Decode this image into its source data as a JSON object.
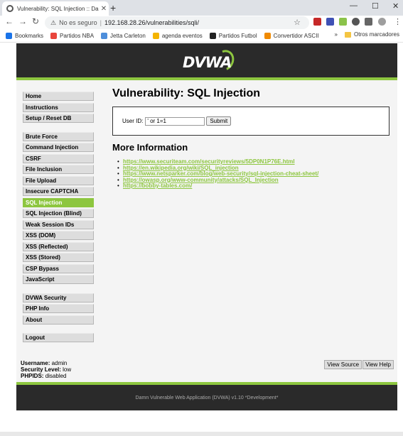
{
  "browser": {
    "tab_title": "Vulnerability: SQL Injection :: Damn",
    "tab_close": "✕",
    "new_tab": "+",
    "window_min": "—",
    "window_max": "☐",
    "window_close": "✕",
    "nav_back": "←",
    "nav_forward": "→",
    "nav_reload": "↻",
    "security_label": "No es seguro",
    "url": "192.168.28.26/vulnerabilities/sqli/",
    "bookmarks": [
      {
        "label": "Bookmarks",
        "icon": "star-icon",
        "color": "#1a73e8"
      },
      {
        "label": "Partidos NBA",
        "icon": "partidos-nba-icon",
        "color": "#e8453c"
      },
      {
        "label": "Jetta Carleton",
        "icon": "jetta-icon",
        "color": "#4d8edb"
      },
      {
        "label": "agenda eventos",
        "icon": "agenda-icon",
        "color": "#f4b400"
      },
      {
        "label": "Partidos Futbol",
        "icon": "futbol-icon",
        "color": "#222222"
      },
      {
        "label": "Convertidor ASCII",
        "icon": "ascii-icon",
        "color": "#f08a00"
      }
    ],
    "bookmarks_overflow": "»",
    "other_bookmarks": "Otros marcadores"
  },
  "dvwa": {
    "logo_text": "DVWA",
    "menu": {
      "group1": [
        "Home",
        "Instructions",
        "Setup / Reset DB"
      ],
      "group2": [
        "Brute Force",
        "Command Injection",
        "CSRF",
        "File Inclusion",
        "File Upload",
        "Insecure CAPTCHA",
        "SQL Injection",
        "SQL Injection (Blind)",
        "Weak Session IDs",
        "XSS (DOM)",
        "XSS (Reflected)",
        "XSS (Stored)",
        "CSP Bypass",
        "JavaScript"
      ],
      "group3": [
        "DVWA Security",
        "PHP Info",
        "About"
      ],
      "group4": [
        "Logout"
      ]
    },
    "active_item": "SQL Injection",
    "page_title": "Vulnerability: SQL Injection",
    "form": {
      "label": "User ID:",
      "value": "' or 1=1",
      "submit": "Submit"
    },
    "more_info_title": "More Information",
    "links": [
      "https://www.securiteam.com/securityreviews/5DP0N1P76E.html",
      "https://en.wikipedia.org/wiki/SQL_injection",
      "https://www.netsparker.com/blog/web-security/sql-injection-cheat-sheet/",
      "https://owasp.org/www-community/attacks/SQL_Injection",
      "https://bobby-tables.com/"
    ],
    "user_info": {
      "username_label": "Username:",
      "username": "admin",
      "security_label": "Security Level:",
      "security": "low",
      "phpids_label": "PHPIDS:",
      "phpids": "disabled"
    },
    "view_source": "View Source",
    "view_help": "View Help",
    "footer": "Damn Vulnerable Web Application (DVWA) v1.10 *Development*"
  },
  "colors": {
    "accent": "#8dc63f",
    "header_bg": "#2a2a2a"
  }
}
